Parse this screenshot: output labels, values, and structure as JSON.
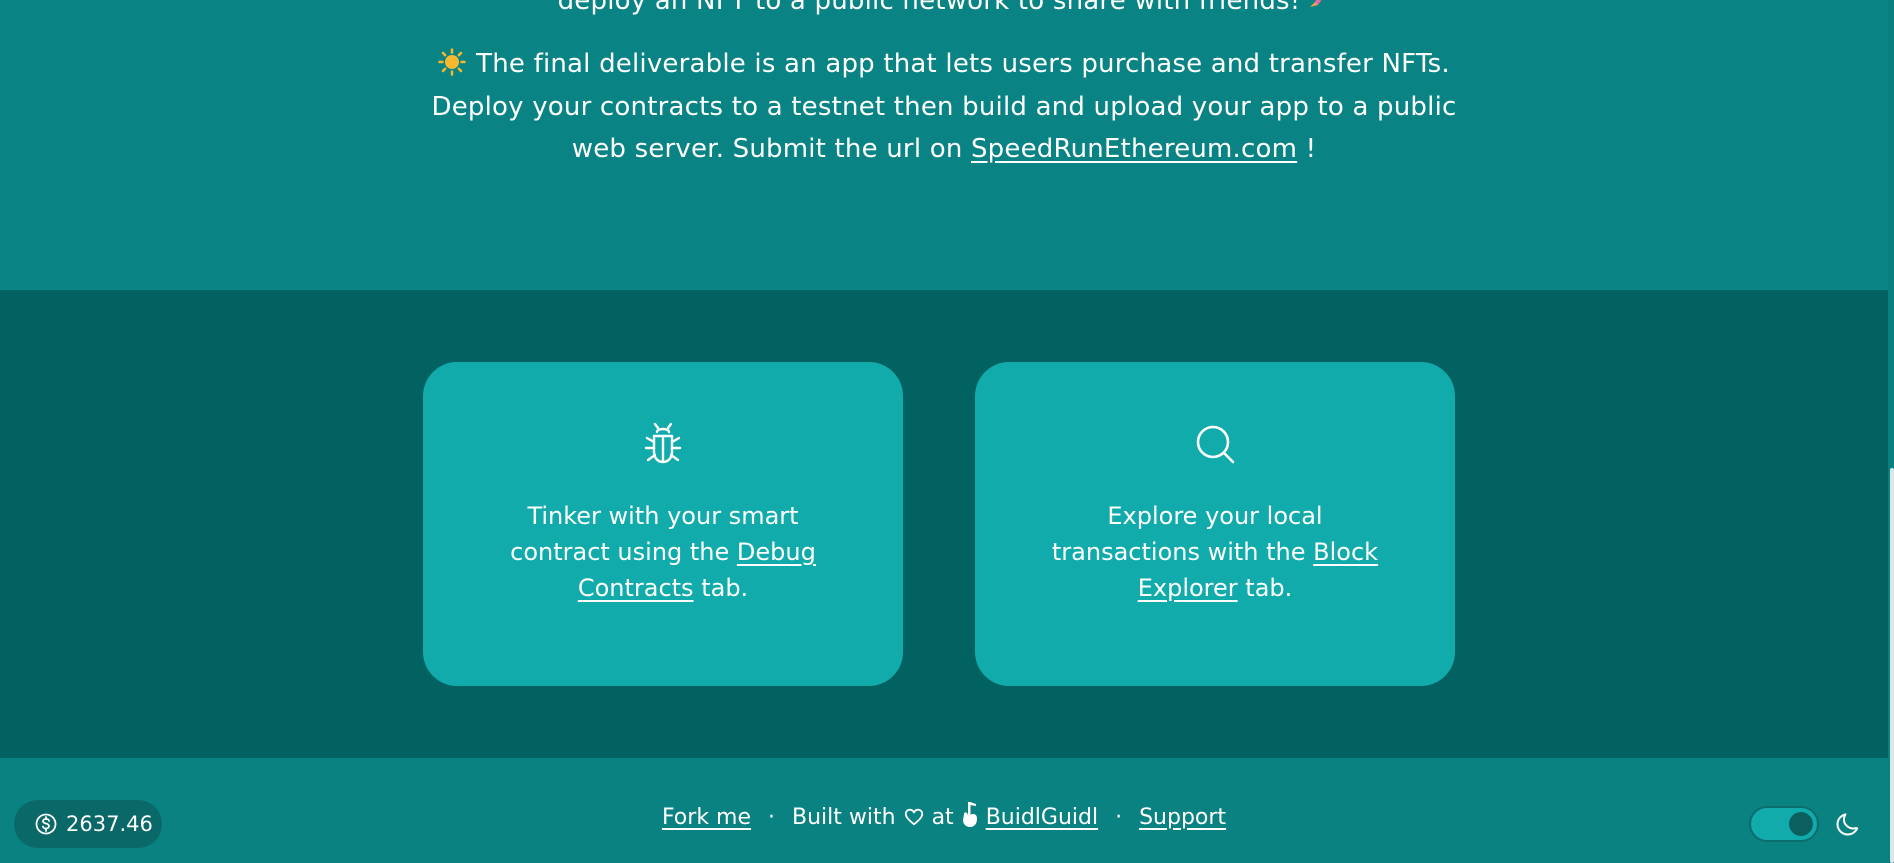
{
  "hero": {
    "line0": "deploy an NFT to a public network to share with friends!",
    "line1": "The final deliverable is an app that lets users purchase and transfer NFTs.",
    "line2": "Deploy your contracts to a testnet then build and upload your app to a public",
    "line3_prefix": "web server. Submit the url on",
    "line3_link": "SpeedRunEthereum.com",
    "line3_suffix": "!"
  },
  "cards": [
    {
      "icon": "bug-icon",
      "text_before": "Tinker with your smart contract using the",
      "link": "Debug Contracts",
      "text_after": "tab."
    },
    {
      "icon": "search-icon",
      "text_before": "Explore your local transactions with the",
      "link": "Block Explorer",
      "text_after": "tab."
    }
  ],
  "footer": {
    "price": "2637.46",
    "fork_label": "Fork me",
    "built_with": "Built with",
    "at": "at",
    "buidlguidl_label": "BuidlGuidl",
    "support_label": "Support",
    "separator": "·"
  },
  "colors": {
    "hero_bg": "#098383",
    "band_bg": "#026161",
    "card_bg": "#11abab",
    "footer_bg": "#0a8282"
  }
}
